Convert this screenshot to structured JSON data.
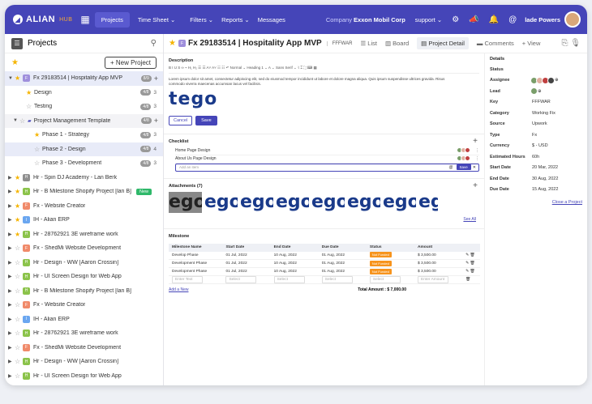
{
  "topbar": {
    "logo": "ALIAN",
    "logo_suffix": "HUB",
    "nav": [
      "Projects",
      "Time Sheet ⌄",
      "Filters ⌄",
      "Reports ⌄",
      "Messages"
    ],
    "company_label": "Company",
    "company_name": "Exxon Mobil Corp",
    "support": "support ⌄",
    "user": "lade Powers"
  },
  "sidebar": {
    "title": "Projects",
    "new_project": "+ New Project",
    "items": [
      {
        "label": "Fx 29183514 | Hospitality App MVP",
        "count": "8/9",
        "num": "",
        "starred": true,
        "color": "#9f8fdc",
        "letter": "F",
        "caret": "▼",
        "indent": 0,
        "state": "sel"
      },
      {
        "label": "Design",
        "count": "4/8",
        "num": "3",
        "starred": true,
        "color": "",
        "letter": "",
        "caret": "",
        "indent": 14,
        "state": ""
      },
      {
        "label": "Testing",
        "count": "4/8",
        "num": "3",
        "starred": false,
        "color": "",
        "letter": "",
        "caret": "",
        "indent": 14,
        "state": ""
      },
      {
        "label": "Project Management Template",
        "count": "4/8",
        "num": "",
        "starred": false,
        "color": "",
        "letter": "",
        "caret": "▼",
        "indent": 6,
        "state": "hl",
        "folder": true
      },
      {
        "label": "Phase 1 - Strategy",
        "count": "4/8",
        "num": "3",
        "starred": true,
        "color": "",
        "letter": "",
        "caret": "",
        "indent": 24,
        "state": ""
      },
      {
        "label": "Phase 2 - Design",
        "count": "4/8",
        "num": "4",
        "starred": false,
        "color": "",
        "letter": "",
        "caret": "",
        "indent": 24,
        "state": "sel"
      },
      {
        "label": "Phase 3 - Development",
        "count": "4/8",
        "num": "3",
        "starred": false,
        "color": "",
        "letter": "",
        "caret": "",
        "indent": 24,
        "state": ""
      },
      {
        "label": "Hr - Spin DJ Academy - Lan Berk",
        "count": "",
        "num": "",
        "starred": true,
        "color": "#8f8f8f",
        "letter": "H",
        "caret": "▶",
        "indent": 0,
        "state": ""
      },
      {
        "label": "Hr - B Milestone Shopify Project [lan B]",
        "count": "",
        "num": "",
        "starred": true,
        "color": "#8bc34a",
        "letter": "H",
        "caret": "▶",
        "indent": 0,
        "state": "",
        "badge": "New"
      },
      {
        "label": "Fx - Website Creator",
        "count": "",
        "num": "",
        "starred": true,
        "color": "#f08a6a",
        "letter": "F",
        "caret": "▶",
        "indent": 0,
        "state": ""
      },
      {
        "label": "IH - Alian ERP",
        "count": "",
        "num": "",
        "starred": true,
        "color": "#6aa6f0",
        "letter": "I",
        "caret": "▶",
        "indent": 0,
        "state": ""
      },
      {
        "label": "Hr - 28762921 3E wireframe work",
        "count": "",
        "num": "",
        "starred": true,
        "color": "#8bc34a",
        "letter": "H",
        "caret": "▶",
        "indent": 0,
        "state": ""
      },
      {
        "label": "Fx - ShedMi Website Development",
        "count": "",
        "num": "",
        "starred": false,
        "color": "#f08a6a",
        "letter": "F",
        "caret": "▶",
        "indent": 0,
        "state": ""
      },
      {
        "label": "Hr - Design - WW [Aaron Crossin]",
        "count": "",
        "num": "",
        "starred": false,
        "color": "#8bc34a",
        "letter": "H",
        "caret": "▶",
        "indent": 0,
        "state": ""
      },
      {
        "label": "Hr - UI Screen Design for Web App",
        "count": "",
        "num": "",
        "starred": false,
        "color": "#8bc34a",
        "letter": "H",
        "caret": "▶",
        "indent": 0,
        "state": ""
      },
      {
        "label": "Hr - B Milestone Shopify Project [lan B]",
        "count": "",
        "num": "",
        "starred": false,
        "color": "#8bc34a",
        "letter": "H",
        "caret": "▶",
        "indent": 0,
        "state": ""
      },
      {
        "label": "Fx - Website Creator",
        "count": "",
        "num": "",
        "starred": false,
        "color": "#f08a6a",
        "letter": "F",
        "caret": "▶",
        "indent": 0,
        "state": ""
      },
      {
        "label": "IH - Alian ERP",
        "count": "",
        "num": "",
        "starred": false,
        "color": "#6aa6f0",
        "letter": "I",
        "caret": "▶",
        "indent": 0,
        "state": ""
      },
      {
        "label": "Hr - 28762921 3E wireframe work",
        "count": "",
        "num": "",
        "starred": false,
        "color": "#8bc34a",
        "letter": "H",
        "caret": "▶",
        "indent": 0,
        "state": ""
      },
      {
        "label": "Fx - ShedMi Website Development",
        "count": "",
        "num": "",
        "starred": false,
        "color": "#f08a6a",
        "letter": "F",
        "caret": "▶",
        "indent": 0,
        "state": ""
      },
      {
        "label": "Hr - Design - WW [Aaron Crossin]",
        "count": "",
        "num": "",
        "starred": false,
        "color": "#8bc34a",
        "letter": "H",
        "caret": "▶",
        "indent": 0,
        "state": ""
      },
      {
        "label": "Hr - UI Screen Design for Web App",
        "count": "",
        "num": "",
        "starred": false,
        "color": "#8bc34a",
        "letter": "H",
        "caret": "▶",
        "indent": 0,
        "state": ""
      }
    ]
  },
  "project": {
    "letter": "F",
    "title": "Fx 29183514 | Hospitality App MVP",
    "code": "FFFWAR",
    "tabs": [
      "List",
      "Board",
      "Project Detail",
      "Comments"
    ],
    "view": "+ View"
  },
  "description": {
    "label": "Description",
    "toolbar": "B  I  U  S    ∞  ⌁  H₁ H₂   ☰  ☰   A˅  A˅   ☷  ☷    ↶    Normal  ⌄    Heading 1  ⌄    A  ⌄    Sans Serif  ⌄    ⌇   ⌶    ⛶  ⌨  ▦",
    "text": "Lorem ipsum dolor sit amet, consectetur adipiscing elit, sed do eiusmod tempor incididunt ut labore et dolore magna aliqua. Quis ipsum suspendisse ultrices gravida. Risus commodo viverra maecenas accumsan lacus vel facilisis.",
    "logo_text": "tego",
    "cancel": "Cancel",
    "save": "Save"
  },
  "checklist": {
    "label": "Checklist",
    "items": [
      "Home Page Design",
      "About Us Page Design"
    ],
    "placeholder": "Add an item",
    "save": "Save"
  },
  "attachments": {
    "label": "Attachments (7)",
    "tiles": [
      "ego",
      "ego",
      "ego",
      "ego",
      "ego",
      "ego",
      "ego",
      "eg"
    ],
    "see_all": "See All"
  },
  "milestone": {
    "label": "Milestone",
    "headers": [
      "Milestone Name",
      "Start Date",
      "End Date",
      "Due Date",
      "Status",
      "Amount",
      ""
    ],
    "rows": [
      {
        "name": "Develop Phase",
        "start": "01 Jul, 2022",
        "end": "10 Aug, 2022",
        "due": "01 Aug, 2022",
        "status": "Not Funded",
        "status_color": "#f7941d",
        "amount": "$ 3,500.00"
      },
      {
        "name": "Development Phase",
        "start": "01 Jul, 2022",
        "end": "10 Aug, 2022",
        "due": "01 Aug, 2022",
        "status": "Not Funded",
        "status_color": "#f7941d",
        "amount": "$ 3,500.00"
      },
      {
        "name": "Development Phase",
        "start": "01 Jul, 2022",
        "end": "10 Aug, 2022",
        "due": "01 Aug, 2022",
        "status": "Not Funded",
        "status_color": "#f7941d",
        "amount": "$ 3,500.00"
      }
    ],
    "new_row": {
      "name": "Enter Text",
      "start": "Select",
      "end": "Select",
      "due": "Select",
      "status": "Select",
      "amount": "Enter Amount"
    },
    "add_new": "Add a New",
    "total": "Total Amount : $ 7,000.00"
  },
  "details": {
    "label": "Details",
    "fields": [
      {
        "k": "Status",
        "v": ""
      },
      {
        "k": "Assignee",
        "v": ""
      },
      {
        "k": "Lead",
        "v": ""
      },
      {
        "k": "Key",
        "v": "FFFWAR"
      },
      {
        "k": "Category",
        "v": "Working Fix"
      },
      {
        "k": "Source",
        "v": "Upwork"
      },
      {
        "k": "Type",
        "v": "Fx"
      },
      {
        "k": "Currency",
        "v": "$ - USD"
      },
      {
        "k": "Estimated Hours",
        "v": "60h"
      },
      {
        "k": "Start Date",
        "v": "20 Mar, 2022"
      },
      {
        "k": "End Date",
        "v": "30 Aug, 2022"
      },
      {
        "k": "Due Date",
        "v": "15 Aug, 2022"
      }
    ],
    "close": "Close a Project"
  }
}
